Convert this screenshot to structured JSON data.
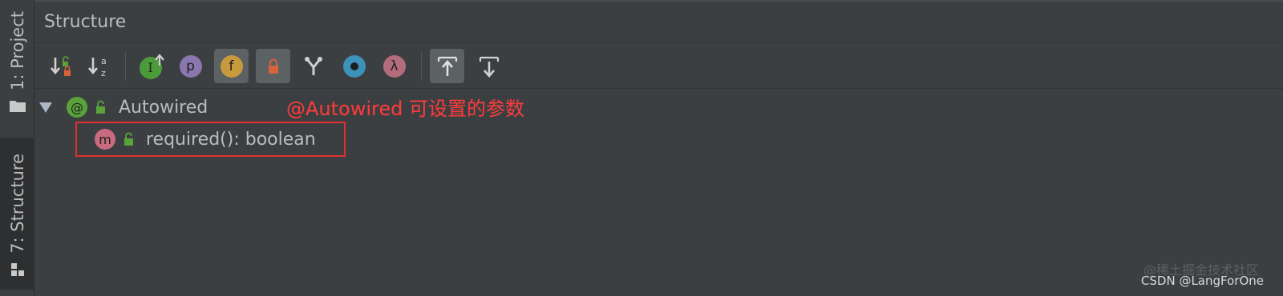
{
  "stripe": {
    "project_label": "1: Project",
    "structure_label": "7: Structure"
  },
  "header": {
    "title": "Structure"
  },
  "toolbar": {
    "buttons": [
      {
        "name": "sort-by-visibility",
        "icon": "sort-visibility-icon"
      },
      {
        "name": "sort-alphabetically",
        "icon": "sort-alpha-icon"
      },
      {
        "name": "show-inherited",
        "icon": "inherited-icon",
        "glyph": "I"
      },
      {
        "name": "show-properties",
        "icon": "property-icon",
        "glyph": "p"
      },
      {
        "name": "show-fields",
        "icon": "field-icon",
        "glyph": "f"
      },
      {
        "name": "show-non-public",
        "icon": "lock-icon"
      },
      {
        "name": "show-anonymous",
        "icon": "anonymous-icon"
      },
      {
        "name": "show-lambdas",
        "icon": "lambda-icon",
        "glyph": "λ"
      },
      {
        "name": "autoscroll-to-source",
        "icon": "autoscroll-to-source-icon"
      },
      {
        "name": "autoscroll-from-source",
        "icon": "autoscroll-from-source-icon"
      }
    ],
    "colors": {
      "inherited": "#4b9b3a",
      "property": "#8b77b0",
      "field": "#c79a3e",
      "lock": "#d8623c",
      "anonymous": "#3c92b8",
      "lambda": "#b36c7a"
    }
  },
  "tree": {
    "root": {
      "icon_glyph": "@",
      "label": "Autowired",
      "icon_color": "#5aa33b"
    },
    "children": [
      {
        "icon_glyph": "m",
        "label": "required(): boolean",
        "icon_color": "#c86b7f"
      }
    ]
  },
  "annotation": {
    "text": "@Autowired 可设置的参数",
    "color": "#ff3b3b"
  },
  "watermark": {
    "main": "CSDN @LangForOne",
    "faint": "@稀土掘金技术社区"
  }
}
